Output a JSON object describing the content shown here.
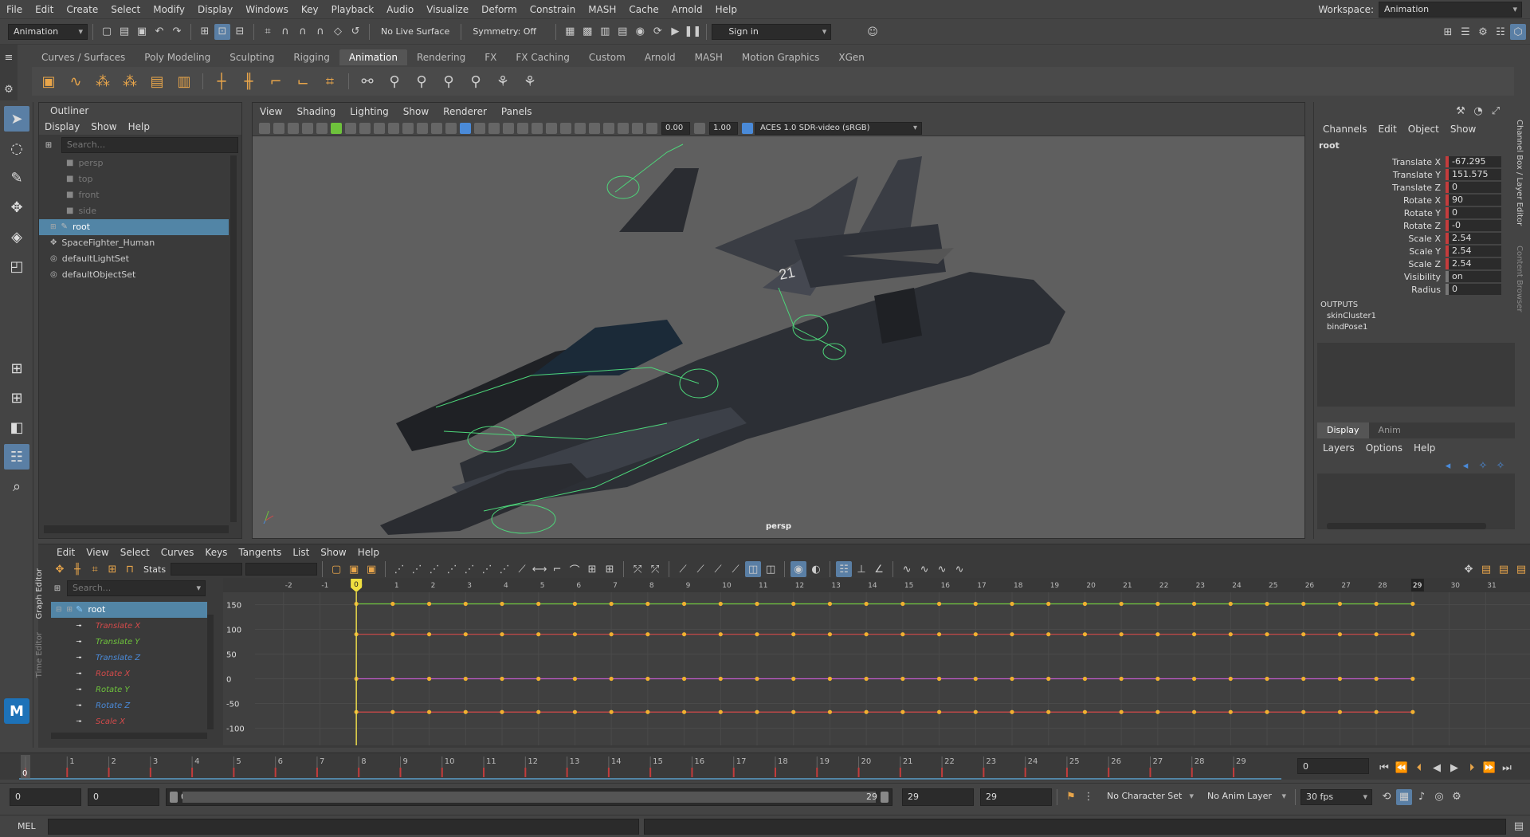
{
  "menubar": {
    "items": [
      "File",
      "Edit",
      "Create",
      "Select",
      "Modify",
      "Display",
      "Windows",
      "Key",
      "Playback",
      "Audio",
      "Visualize",
      "Deform",
      "Constrain",
      "MASH",
      "Cache",
      "Arnold",
      "Help"
    ],
    "workspace_label": "Workspace:",
    "workspace_value": "Animation"
  },
  "statusline": {
    "menuset": "Animation",
    "live_surface": "No Live Surface",
    "symmetry": "Symmetry: Off",
    "sign_in": "Sign in"
  },
  "shelf": {
    "tabs": [
      "Curves / Surfaces",
      "Poly Modeling",
      "Sculpting",
      "Rigging",
      "Animation",
      "Rendering",
      "FX",
      "FX Caching",
      "Custom",
      "Arnold",
      "MASH",
      "Motion Graphics",
      "XGen"
    ],
    "active_tab": "Animation"
  },
  "outliner": {
    "title": "Outliner",
    "menus": [
      "Display",
      "Show",
      "Help"
    ],
    "search_placeholder": "Search...",
    "items": [
      {
        "label": "persp",
        "kind": "camera"
      },
      {
        "label": "top",
        "kind": "camera"
      },
      {
        "label": "front",
        "kind": "camera"
      },
      {
        "label": "side",
        "kind": "camera"
      },
      {
        "label": "root",
        "kind": "joint"
      },
      {
        "label": "SpaceFighter_Human",
        "kind": "mesh"
      },
      {
        "label": "defaultLightSet",
        "kind": "set"
      },
      {
        "label": "defaultObjectSet",
        "kind": "set"
      }
    ],
    "selected": "root"
  },
  "viewport": {
    "menus": [
      "View",
      "Shading",
      "Lighting",
      "Show",
      "Renderer",
      "Panels"
    ],
    "near_value": "0.00",
    "far_value": "1.00",
    "color_space": "ACES 1.0 SDR-video (sRGB)",
    "camera_label": "persp"
  },
  "channelbox": {
    "menus": [
      "Channels",
      "Edit",
      "Object",
      "Show"
    ],
    "node": "root",
    "channels": [
      {
        "label": "Translate X",
        "value": "-67.295",
        "keyed": true
      },
      {
        "label": "Translate Y",
        "value": "151.575",
        "keyed": true
      },
      {
        "label": "Translate Z",
        "value": "0",
        "keyed": true
      },
      {
        "label": "Rotate X",
        "value": "90",
        "keyed": true
      },
      {
        "label": "Rotate Y",
        "value": "0",
        "keyed": true
      },
      {
        "label": "Rotate Z",
        "value": "-0",
        "keyed": true
      },
      {
        "label": "Scale X",
        "value": "2.54",
        "keyed": true
      },
      {
        "label": "Scale Y",
        "value": "2.54",
        "keyed": true
      },
      {
        "label": "Scale Z",
        "value": "2.54",
        "keyed": true
      },
      {
        "label": "Visibility",
        "value": "on",
        "keyed": false
      },
      {
        "label": "Radius",
        "value": "0",
        "keyed": false
      }
    ],
    "outputs_label": "OUTPUTS",
    "outputs": [
      "skinCluster1",
      "bindPose1"
    ],
    "side_tabs": [
      "Channel Box / Layer Editor",
      "Content Browser"
    ]
  },
  "layereditor": {
    "tabs": [
      "Display",
      "Anim"
    ],
    "active_tab": "Display",
    "menus": [
      "Layers",
      "Options",
      "Help"
    ]
  },
  "grapheditor": {
    "side_label": "Graph Editor",
    "side_label2": "Time Editor",
    "menus": [
      "Edit",
      "View",
      "Select",
      "Curves",
      "Keys",
      "Tangents",
      "List",
      "Show",
      "Help"
    ],
    "stats_label": "Stats",
    "search_placeholder": "Search...",
    "node": "root",
    "curves": [
      {
        "label": "Translate X",
        "color": "#d44a4a"
      },
      {
        "label": "Translate Y",
        "color": "#6ec23c"
      },
      {
        "label": "Translate Z",
        "color": "#4a8ad8"
      },
      {
        "label": "Rotate X",
        "color": "#d44a4a"
      },
      {
        "label": "Rotate Y",
        "color": "#6ec23c"
      },
      {
        "label": "Rotate Z",
        "color": "#4a8ad8"
      },
      {
        "label": "Scale X",
        "color": "#d44a4a"
      }
    ],
    "current_frame": "0",
    "end_frame_marker": "29",
    "y_ticks": [
      "150",
      "100",
      "50",
      "0",
      "-50",
      "-100"
    ],
    "frame_ticks": [
      "-2",
      "-1",
      "0",
      "1",
      "2",
      "3",
      "4",
      "5",
      "6",
      "7",
      "8",
      "9",
      "10",
      "11",
      "12",
      "13",
      "14",
      "15",
      "16",
      "17",
      "18",
      "19",
      "20",
      "21",
      "22",
      "23",
      "24",
      "25",
      "26",
      "27",
      "28",
      "29",
      "30",
      "31"
    ]
  },
  "chart_data": {
    "type": "line",
    "x": [
      0,
      1,
      2,
      3,
      4,
      5,
      6,
      7,
      8,
      9,
      10,
      11,
      12,
      13,
      14,
      15,
      16,
      17,
      18,
      19,
      20,
      21,
      22,
      23,
      24,
      25,
      26,
      27,
      28,
      29
    ],
    "series": [
      {
        "name": "Translate Y",
        "value": 151.575,
        "color": "#6ec23c"
      },
      {
        "name": "Rotate X",
        "value": 90,
        "color": "#d44a4a"
      },
      {
        "name": "Translate Z",
        "value": 0,
        "color": "#c05ac8"
      },
      {
        "name": "Translate X",
        "value": -67.295,
        "color": "#d44a4a"
      }
    ],
    "ylim": [
      -125,
      175
    ],
    "xlim": [
      -3,
      32
    ]
  },
  "timeslider": {
    "ticks": [
      "1",
      "2",
      "3",
      "4",
      "5",
      "6",
      "7",
      "8",
      "9",
      "10",
      "11",
      "12",
      "13",
      "14",
      "15",
      "16",
      "17",
      "18",
      "19",
      "20",
      "21",
      "22",
      "23",
      "24",
      "25",
      "26",
      "27",
      "28",
      "29"
    ],
    "current_frame": "0",
    "current_frame_field": "0"
  },
  "rangeslider": {
    "start_field": "0",
    "anim_start_field": "0",
    "slider_start": "0",
    "slider_end": "29",
    "end_field": "29",
    "anim_end_field": "29",
    "character_set": "No Character Set",
    "anim_layer": "No Anim Layer",
    "fps": "30 fps"
  },
  "cmdline": {
    "label": "MEL"
  }
}
